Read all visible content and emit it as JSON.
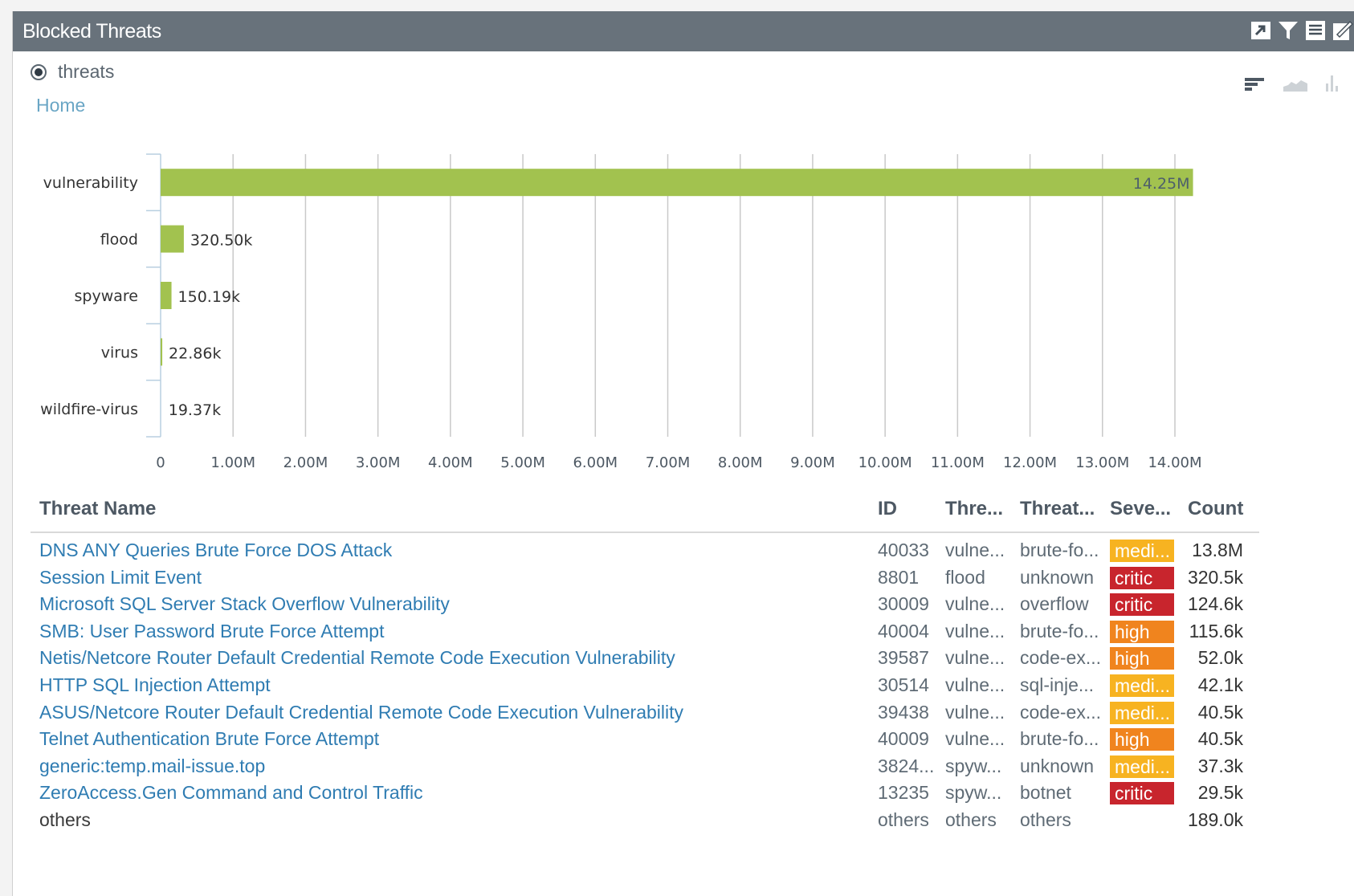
{
  "widget": {
    "title": "Blocked Threats"
  },
  "toolbar": {
    "icons": [
      "popout-icon",
      "filter-icon",
      "table-icon",
      "edit-icon"
    ]
  },
  "view": {
    "radio_label": "threats",
    "breadcrumb": "Home",
    "chart_type_icons": [
      "horizontal-bar-icon",
      "area-chart-icon",
      "column-chart-icon"
    ]
  },
  "colors": {
    "bar": "#a2c24f",
    "critical": "#c8252d",
    "high": "#f0841e",
    "medium": "#f7b321",
    "link": "#2f7cb2"
  },
  "chart_data": {
    "type": "bar",
    "orientation": "horizontal",
    "categories": [
      "vulnerability",
      "flood",
      "spyware",
      "virus",
      "wildfire-virus"
    ],
    "values": [
      14250000,
      320500,
      150190,
      22860,
      19370
    ],
    "value_labels": [
      "14.25M",
      "320.50k",
      "150.19k",
      "22.86k",
      "19.37k"
    ],
    "xlim": [
      0,
      14000000
    ],
    "x_ticks": [
      0,
      1000000,
      2000000,
      3000000,
      4000000,
      5000000,
      6000000,
      7000000,
      8000000,
      9000000,
      10000000,
      11000000,
      12000000,
      13000000,
      14000000
    ],
    "x_tick_labels": [
      "0",
      "1.00M",
      "2.00M",
      "3.00M",
      "4.00M",
      "5.00M",
      "6.00M",
      "7.00M",
      "8.00M",
      "9.00M",
      "10.00M",
      "11.00M",
      "12.00M",
      "13.00M",
      "14.00M"
    ],
    "grid": true
  },
  "table": {
    "headers": {
      "name": "Threat Name",
      "id": "ID",
      "type": "Thre...",
      "subtype": "Threat...",
      "severity": "Seve...",
      "count": "Count"
    },
    "rows": [
      {
        "name": "DNS ANY Queries Brute Force DOS Attack",
        "id": "40033",
        "type": "vulne...",
        "subtype": "brute-fo...",
        "severity": "medi...",
        "level": "medium",
        "count": "13.8M"
      },
      {
        "name": "Session Limit Event",
        "id": "8801",
        "type": "flood",
        "subtype": "unknown",
        "severity": "critic",
        "level": "critical",
        "count": "320.5k"
      },
      {
        "name": "Microsoft SQL Server Stack Overflow Vulnerability",
        "id": "30009",
        "type": "vulne...",
        "subtype": "overflow",
        "severity": "critic",
        "level": "critical",
        "count": "124.6k"
      },
      {
        "name": "SMB: User Password Brute Force Attempt",
        "id": "40004",
        "type": "vulne...",
        "subtype": "brute-fo...",
        "severity": "high",
        "level": "high",
        "count": "115.6k"
      },
      {
        "name": "Netis/Netcore Router Default Credential Remote Code Execution Vulnerability",
        "id": "39587",
        "type": "vulne...",
        "subtype": "code-ex...",
        "severity": "high",
        "level": "high",
        "count": "52.0k"
      },
      {
        "name": "HTTP SQL Injection Attempt",
        "id": "30514",
        "type": "vulne...",
        "subtype": "sql-inje...",
        "severity": "medi...",
        "level": "medium",
        "count": "42.1k"
      },
      {
        "name": "ASUS/Netcore Router Default Credential Remote Code Execution Vulnerability",
        "id": "39438",
        "type": "vulne...",
        "subtype": "code-ex...",
        "severity": "medi...",
        "level": "medium",
        "count": "40.5k"
      },
      {
        "name": "Telnet Authentication Brute Force Attempt",
        "id": "40009",
        "type": "vulne...",
        "subtype": "brute-fo...",
        "severity": "high",
        "level": "high",
        "count": "40.5k"
      },
      {
        "name": "generic:temp.mail-issue.top",
        "id": "3824...",
        "type": "spyw...",
        "subtype": "unknown",
        "severity": "medi...",
        "level": "medium",
        "count": "37.3k"
      },
      {
        "name": "ZeroAccess.Gen Command and Control Traffic",
        "id": "13235",
        "type": "spyw...",
        "subtype": "botnet",
        "severity": "critic",
        "level": "critical",
        "count": "29.5k"
      },
      {
        "name": "others",
        "id": "others",
        "type": "others",
        "subtype": "others",
        "severity": "",
        "level": "none",
        "count": "189.0k"
      }
    ]
  }
}
